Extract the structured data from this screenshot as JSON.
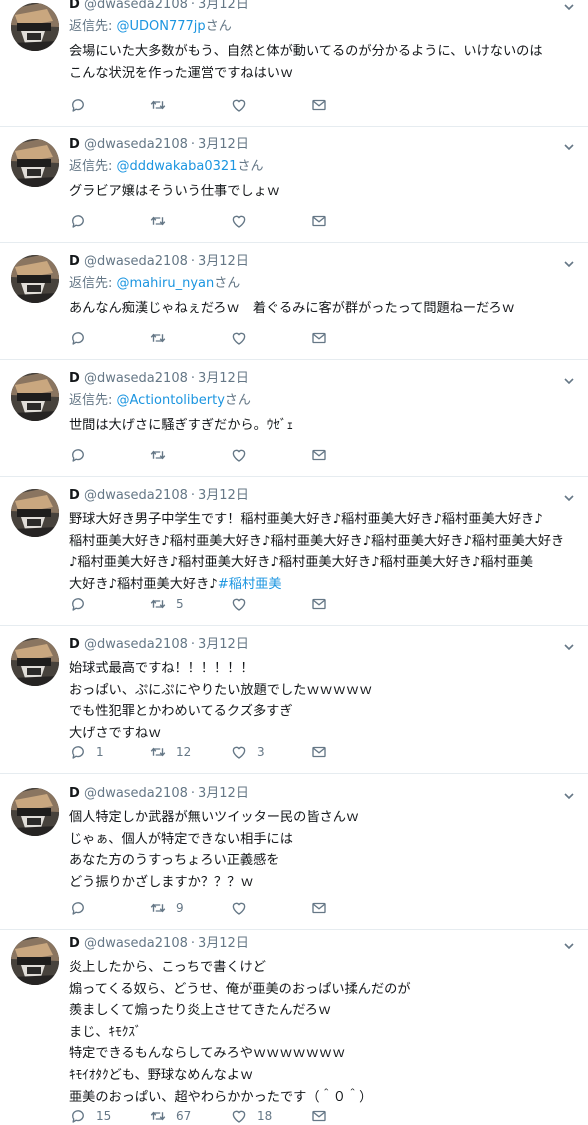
{
  "tweets": [
    {
      "name": "D",
      "handle": "@dwaseda2108",
      "date": "3月12日",
      "reply_prefix": "返信先: ",
      "reply_to": "@UDON777jp",
      "reply_suffix": "さん",
      "lines": [
        "会場にいた大多数がもう、自然と体が動いてるのが分かるように、いけないのは",
        "こんな状況を作った運営ですねはいｗ"
      ],
      "hashtag": "",
      "replies": "",
      "retweets": "",
      "likes": ""
    },
    {
      "name": "D",
      "handle": "@dwaseda2108",
      "date": "3月12日",
      "reply_prefix": "返信先: ",
      "reply_to": "@dddwakaba0321",
      "reply_suffix": "さん",
      "lines": [
        "グラビア嬢はそういう仕事でしょｗ"
      ],
      "hashtag": "",
      "replies": "",
      "retweets": "",
      "likes": ""
    },
    {
      "name": "D",
      "handle": "@dwaseda2108",
      "date": "3月12日",
      "reply_prefix": "返信先: ",
      "reply_to": "@mahiru_nyan",
      "reply_suffix": "さん",
      "lines": [
        "あんなん痴漢じゃねぇだろｗ　着ぐるみに客が群がったって問題ねーだろｗ"
      ],
      "hashtag": "",
      "replies": "",
      "retweets": "",
      "likes": ""
    },
    {
      "name": "D",
      "handle": "@dwaseda2108",
      "date": "3月12日",
      "reply_prefix": "返信先: ",
      "reply_to": "@Actiontoliberty",
      "reply_suffix": "さん",
      "lines": [
        "世間は大げさに騒ぎすぎだから。ｳｾﾞｪ"
      ],
      "hashtag": "",
      "replies": "",
      "retweets": "",
      "likes": ""
    },
    {
      "name": "D",
      "handle": "@dwaseda2108",
      "date": "3月12日",
      "reply_prefix": "",
      "reply_to": "",
      "reply_suffix": "",
      "lines": [
        "野球大好き男子中学生です！稲村亜美大好き♪稲村亜美大好き♪稲村亜美大好き♪",
        "稲村亜美大好き♪稲村亜美大好き♪稲村亜美大好き♪稲村亜美大好き♪稲村亜美大好き",
        "♪稲村亜美大好き♪稲村亜美大好き♪稲村亜美大好き♪稲村亜美大好き♪稲村亜美",
        "大好き♪稲村亜美大好き♪"
      ],
      "hashtag": "#稲村亜美",
      "replies": "",
      "retweets": "5",
      "likes": ""
    },
    {
      "name": "D",
      "handle": "@dwaseda2108",
      "date": "3月12日",
      "reply_prefix": "",
      "reply_to": "",
      "reply_suffix": "",
      "lines": [
        "始球式最高ですね！！！！！！",
        "おっぱい、ぷにぷにやりたい放題でしたｗｗｗｗｗ",
        "でも性犯罪とかわめいてるクズ多すぎ",
        "大げさですねｗ"
      ],
      "hashtag": "",
      "replies": "1",
      "retweets": "12",
      "likes": "3"
    },
    {
      "name": "D",
      "handle": "@dwaseda2108",
      "date": "3月12日",
      "reply_prefix": "",
      "reply_to": "",
      "reply_suffix": "",
      "lines": [
        "個人特定しか武器が無いツイッター民の皆さんｗ",
        "じゃぁ、個人が特定できない相手には",
        "あなた方のうすっちょろい正義感を",
        "どう振りかざしますか？？？ｗ"
      ],
      "hashtag": "",
      "replies": "",
      "retweets": "9",
      "likes": ""
    },
    {
      "name": "D",
      "handle": "@dwaseda2108",
      "date": "3月12日",
      "reply_prefix": "",
      "reply_to": "",
      "reply_suffix": "",
      "lines": [
        "炎上したから、こっちで書くけど",
        "煽ってくる奴ら、どうせ、俺が亜美のおっぱい揉んだのが",
        "羨ましくて煽ったり炎上させてきたんだろｗ",
        "まじ、ｷﾓｸｽﾞ",
        "特定できるもんならしてみろやｗｗｗｗｗｗｗ",
        "ｷﾓｲｵﾀｸども、野球なめんなよｗ",
        "亜美のおっぱい、超やわらかかったです（＾０＾）"
      ],
      "hashtag": "",
      "replies": "15",
      "retweets": "67",
      "likes": "18"
    }
  ]
}
